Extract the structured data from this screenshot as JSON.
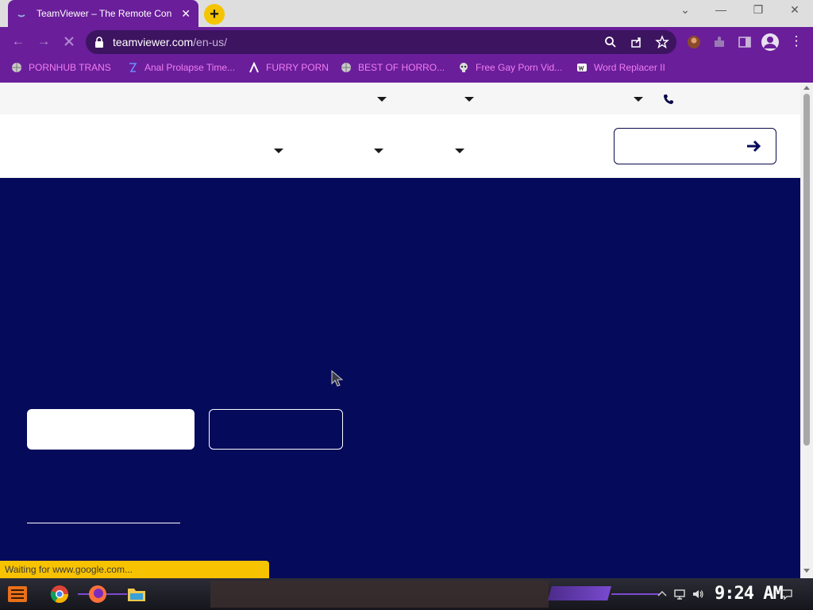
{
  "browser": {
    "tab": {
      "title": "TeamViewer – The Remote Con",
      "close": "✕"
    },
    "newtab": "+",
    "window_controls": {
      "minimize": "—",
      "restore": "❐",
      "close": "✕",
      "tabsearch": "⌄"
    },
    "url": {
      "domain": "teamviewer.com",
      "path": "/en-us/"
    },
    "bookmarks": [
      {
        "label": "PORNHUB TRANS",
        "icon": "globe-icon"
      },
      {
        "label": "Anal Prolapse Time...",
        "icon": "bracket-icon"
      },
      {
        "label": "FURRY PORN",
        "icon": "lambda-icon"
      },
      {
        "label": "BEST OF HORRO...",
        "icon": "globe-icon"
      },
      {
        "label": "Free Gay Porn Vid...",
        "icon": "skull-icon"
      },
      {
        "label": "Word Replacer II",
        "icon": "wr-icon"
      }
    ],
    "status_text": "Waiting for www.google.com..."
  },
  "taskbar": {
    "clock": "9:24 AM"
  },
  "colors": {
    "browser_purple": "#6a1e9a",
    "hero_navy": "#050a5a",
    "bookmark_pink": "#f27df2",
    "status_yellow": "#f7c200",
    "newtab_yellow": "#f5c400"
  }
}
